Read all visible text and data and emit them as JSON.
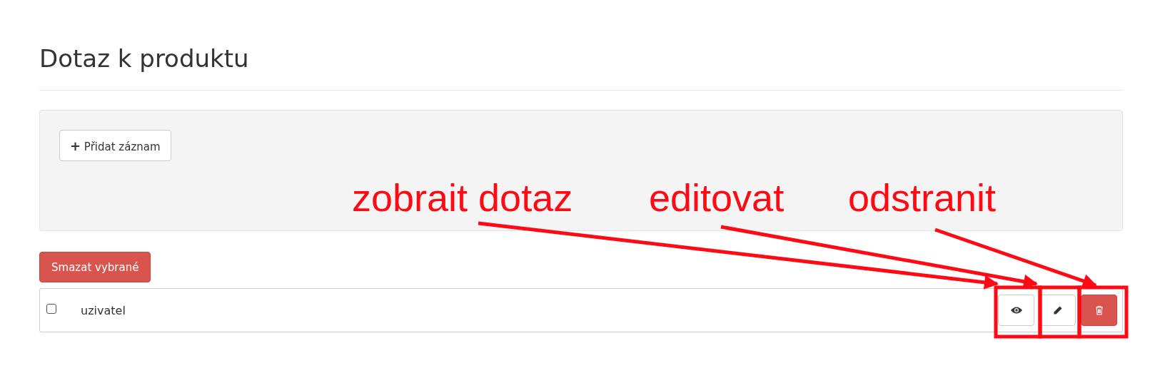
{
  "page_title": "Dotaz k produktu",
  "add_button": {
    "icon": "+",
    "label": "Přidat záznam"
  },
  "delete_selected_button": "Smazat vybrané",
  "rows": [
    {
      "checked": false,
      "name": "uzivatel"
    }
  ],
  "annotations": [
    {
      "text": "zobrait dotaz",
      "kind": "view"
    },
    {
      "text": "editovat",
      "kind": "edit"
    },
    {
      "text": "odstranit",
      "kind": "delete"
    }
  ]
}
